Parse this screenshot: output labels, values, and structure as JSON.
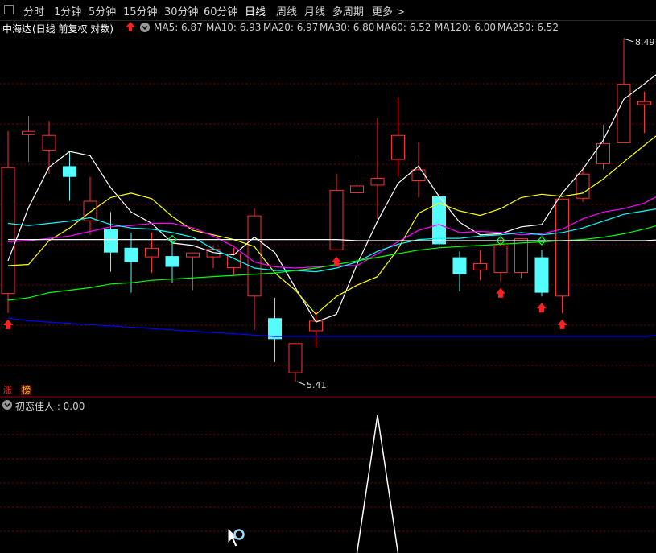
{
  "toolbar": {
    "timeframes": [
      "分时",
      "1分钟",
      "5分钟",
      "15分钟",
      "30分钟",
      "60分钟",
      "日线",
      "周线",
      "月线",
      "多周期",
      "更多"
    ],
    "active": "日线",
    "more_arrow": ">"
  },
  "main_chart": {
    "stock_name": "中海达",
    "period_label": "(日线 前复权 对数)",
    "ma": [
      {
        "label": "MA5: 6.87",
        "color": "#ffffff"
      },
      {
        "label": "MA10: 6.93",
        "color": "#ffff00"
      },
      {
        "label": "MA20: 6.97",
        "color": "#ff00ff"
      },
      {
        "label": "MA30: 6.80",
        "color": "#00ffff"
      },
      {
        "label": "MA60: 6.52",
        "color": "#00ff00"
      },
      {
        "label": "MA120: 6.00",
        "color": "#0000ff"
      },
      {
        "label": "MA250: 6.52",
        "color": "#ffffff"
      }
    ],
    "high_label": "8.49",
    "low_label": "5.41",
    "badges": [
      "涨",
      "榜"
    ]
  },
  "chart_data": {
    "type": "candlestick",
    "ohlc": [
      [
        6.07,
        7.17,
        5.92,
        7.52
      ],
      [
        7.48,
        7.52,
        7.22,
        7.67
      ],
      [
        7.33,
        7.48,
        7.11,
        7.62
      ],
      [
        7.18,
        7.08,
        6.86,
        7.32
      ],
      [
        6.68,
        6.86,
        6.56,
        7.08
      ],
      [
        6.61,
        6.41,
        6.25,
        6.76
      ],
      [
        6.45,
        6.33,
        6.08,
        6.58
      ],
      [
        6.37,
        6.45,
        6.24,
        6.58
      ],
      [
        6.38,
        6.29,
        6.16,
        6.52
      ],
      [
        6.37,
        6.41,
        6.1,
        6.41
      ],
      [
        6.37,
        6.44,
        6.28,
        6.47
      ],
      [
        6.28,
        6.4,
        6.23,
        6.45
      ],
      [
        6.05,
        6.73,
        5.79,
        6.79
      ],
      [
        5.88,
        5.72,
        5.55,
        6.04
      ],
      [
        5.47,
        5.69,
        5.41,
        5.69
      ],
      [
        5.78,
        5.86,
        5.66,
        5.93
      ],
      [
        6.43,
        6.96,
        6.43,
        7.11
      ],
      [
        6.93,
        7.0,
        6.58,
        7.25
      ],
      [
        7.0,
        7.07,
        6.7,
        7.65
      ],
      [
        7.24,
        7.48,
        7.08,
        7.86
      ],
      [
        7.04,
        7.15,
        6.89,
        7.41
      ],
      [
        6.9,
        6.48,
        6.47,
        7.15
      ],
      [
        6.37,
        6.23,
        6.09,
        6.42
      ],
      [
        6.26,
        6.32,
        6.18,
        6.43
      ],
      [
        6.24,
        6.47,
        6.17,
        6.53
      ],
      [
        6.24,
        6.53,
        6.2,
        6.53
      ],
      [
        6.37,
        6.08,
        6.05,
        6.43
      ],
      [
        6.05,
        6.88,
        5.92,
        6.88
      ],
      [
        6.88,
        7.11,
        6.85,
        7.17
      ],
      [
        7.2,
        7.4,
        7.15,
        7.58
      ],
      [
        7.4,
        8.0,
        7.4,
        8.49
      ],
      [
        7.78,
        7.82,
        7.5,
        7.92
      ],
      [
        7.97,
        7.97,
        7.51,
        8.0
      ]
    ],
    "ma_values": {
      "MA5": [
        6.34,
        6.8,
        7.17,
        7.32,
        7.28,
        6.98,
        6.76,
        6.66,
        6.49,
        6.47,
        6.41,
        6.39,
        6.54,
        6.41,
        6.12,
        5.85,
        5.91,
        6.31,
        6.68,
        7.02,
        7.18,
        6.9,
        6.67,
        6.56,
        6.57,
        6.63,
        6.65,
        6.93,
        7.15,
        7.43,
        7.84,
        8.0,
        8.17
      ],
      "MA10": [
        6.3,
        6.31,
        6.51,
        6.62,
        6.76,
        6.89,
        6.93,
        6.88,
        6.72,
        6.6,
        6.56,
        6.52,
        6.46,
        6.24,
        6.1,
        5.91,
        6.05,
        6.14,
        6.21,
        6.44,
        6.75,
        6.84,
        6.77,
        6.73,
        6.79,
        6.89,
        6.92,
        6.9,
        6.93,
        7.06,
        7.22,
        7.38,
        7.54
      ],
      "MA20": [
        6.5,
        6.51,
        6.53,
        6.55,
        6.59,
        6.63,
        6.64,
        6.66,
        6.66,
        6.62,
        6.55,
        6.46,
        6.33,
        6.29,
        6.28,
        6.29,
        6.3,
        6.3,
        6.4,
        6.5,
        6.6,
        6.65,
        6.58,
        6.59,
        6.58,
        6.56,
        6.57,
        6.61,
        6.7,
        6.76,
        6.79,
        6.84,
        6.94
      ],
      "MA30": [
        6.66,
        6.64,
        6.66,
        6.68,
        6.71,
        6.65,
        6.62,
        6.61,
        6.58,
        6.54,
        6.44,
        6.36,
        6.28,
        6.26,
        6.26,
        6.25,
        6.28,
        6.33,
        6.42,
        6.48,
        6.52,
        6.53,
        6.53,
        6.55,
        6.56,
        6.58,
        6.56,
        6.58,
        6.62,
        6.68,
        6.74,
        6.77,
        6.8
      ],
      "MA60": [
        6.02,
        6.04,
        6.08,
        6.1,
        6.12,
        6.15,
        6.16,
        6.18,
        6.19,
        6.2,
        6.21,
        6.22,
        6.23,
        6.24,
        6.26,
        6.28,
        6.31,
        6.34,
        6.37,
        6.4,
        6.43,
        6.45,
        6.46,
        6.47,
        6.48,
        6.49,
        6.5,
        6.51,
        6.52,
        6.54,
        6.57,
        6.61,
        6.66
      ],
      "MA120": [
        5.88,
        5.86,
        5.85,
        5.84,
        5.83,
        5.82,
        5.81,
        5.8,
        5.79,
        5.78,
        5.77,
        5.76,
        5.75,
        5.74,
        5.74,
        5.74,
        5.74,
        5.74,
        5.74,
        5.74,
        5.74,
        5.74,
        5.74,
        5.74,
        5.74,
        5.74,
        5.74,
        5.74,
        5.74,
        5.74,
        5.74,
        5.74,
        5.75
      ],
      "MA250": [
        6.52,
        6.52,
        6.52,
        6.52,
        6.52,
        6.52,
        6.52,
        6.52,
        6.52,
        6.52,
        6.52,
        6.52,
        6.52,
        6.52,
        6.52,
        6.52,
        6.52,
        6.51,
        6.51,
        6.51,
        6.51,
        6.51,
        6.51,
        6.51,
        6.51,
        6.51,
        6.51,
        6.51,
        6.51,
        6.51,
        6.51,
        6.51,
        6.52
      ]
    },
    "buy_arrow_candles": [
      0,
      16,
      24,
      26,
      27
    ],
    "diamond_candles": [
      8,
      24,
      26
    ],
    "indicator": {
      "label": "初恋佳人 : 0.00",
      "spike_candle": 18
    },
    "log_scale": true,
    "grid": true
  }
}
